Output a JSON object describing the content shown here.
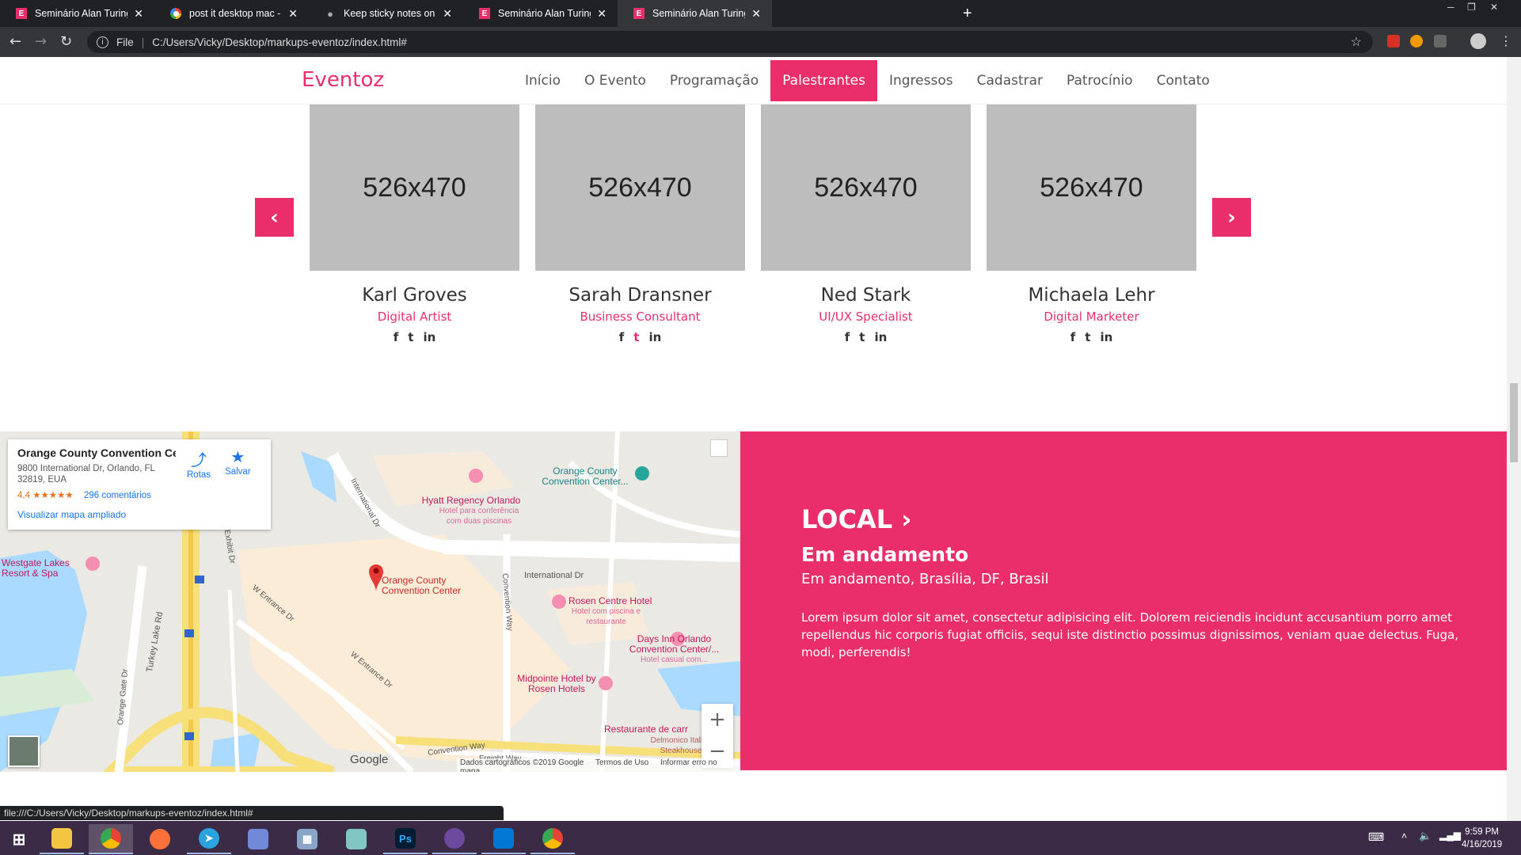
{
  "browser": {
    "tabs": [
      {
        "title": "Seminário Alan Turing",
        "favicon": "pink-e-icon"
      },
      {
        "title": "post it desktop mac - Pesquisa G",
        "favicon": "google-icon"
      },
      {
        "title": "Keep sticky notes on your Mac d",
        "favicon": "apple-icon"
      },
      {
        "title": "Seminário Alan Turing",
        "favicon": "pink-e-icon"
      },
      {
        "title": "Seminário Alan Turing",
        "favicon": "pink-e-icon"
      }
    ],
    "address_scheme": "File",
    "address": "C:/Users/Vicky/Desktop/markups-eventoz/index.html#",
    "status_url": "file:///C:/Users/Vicky/Desktop/markups-eventoz/index.html#"
  },
  "site": {
    "logo": "Eventoz",
    "accent": "#ea2e6c",
    "menu": [
      "Início",
      "O Evento",
      "Programação",
      "Palestrantes",
      "Ingressos",
      "Cadastrar",
      "Patrocínio",
      "Contato"
    ],
    "active_menu": "Palestrantes"
  },
  "speakers": [
    {
      "image": "526x470",
      "name": "Karl Groves",
      "role": "Digital Artist",
      "social": [
        "f",
        "t",
        "in"
      ]
    },
    {
      "image": "526x470",
      "name": "Sarah Dransner",
      "role": "Business Consultant",
      "social": [
        "f",
        "t",
        "in"
      ],
      "highlight": "t"
    },
    {
      "image": "526x470",
      "name": "Ned Stark",
      "role": "UI/UX Specialist",
      "social": [
        "f",
        "t",
        "in"
      ]
    },
    {
      "image": "526x470",
      "name": "Michaela Lehr",
      "role": "Digital Marketer",
      "social": [
        "f",
        "t",
        "in"
      ]
    }
  ],
  "map": {
    "place_title": "Orange County Convention Ce...",
    "place_address": "9800 International Dr, Orlando, FL 32819, EUA",
    "rating": "4,4 ★★★★★",
    "reviews": "296 comentários",
    "larger_map": "Visualizar mapa ampliado",
    "directions": "Rotas",
    "save": "Salvar",
    "labels": {
      "hyatt": "Hyatt Regency Orlando",
      "hyatt_sub": "Hotel para conferência com duas piscinas",
      "occc_top": "Orange County Convention Center...",
      "westgate": "Westgate Lakes Resort & Spa",
      "occc_pin": "Orange County Convention Center",
      "rosen": "Rosen Centre Hotel",
      "rosen_sub": "Hotel com piscina e restaurante",
      "days_inn": "Days Inn Orlando Convention Center/...",
      "days_inn_sub": "Hotel casual com...",
      "midpointe": "Midpointe Hotel by Rosen Hotels",
      "restaurant": "Restaurante de carr",
      "delmonico": "Delmonico Italian Steakhouse",
      "intl_dr": "International Dr",
      "intl_dr_2": "International Dr",
      "turkey": "Turkey Lake Rd",
      "exhibit": "Exhibit Dr",
      "w_entrance": "W Entrance Dr",
      "convention_way": "Convention Way",
      "freight_way": "Freight Way",
      "orange_gate": "Orange Gate Dr",
      "i4": "4"
    },
    "google": "Google",
    "footer": [
      "Dados cartográficos ©2019 Google",
      "Termos de Uso",
      "Informar erro no mapa"
    ],
    "zoom_in": "+",
    "zoom_out": "−"
  },
  "local": {
    "heading": "LOCAL",
    "subheading": "Em andamento",
    "address": "Em andamento, Brasília, DF, Brasil",
    "description": "Lorem ipsum dolor sit amet, consectetur adipisicing elit. Dolorem reiciendis incidunt accusantium porro amet repellendus hic corporis fugiat officiis, sequi iste distinctio possimus dignissimos, veniam quae delectus. Fuga, modi, perferendis!"
  },
  "taskbar": {
    "time": "9:59 PM",
    "date": "4/16/2019",
    "apps": [
      "windows-start-icon",
      "file-explorer-icon",
      "chrome-icon",
      "firefox-icon",
      "telegram-icon",
      "discord-icon",
      "calculator-icon",
      "notes-icon",
      "photoshop-icon",
      "github-desktop-icon",
      "vscode-icon",
      "chrome-dev-icon"
    ]
  }
}
